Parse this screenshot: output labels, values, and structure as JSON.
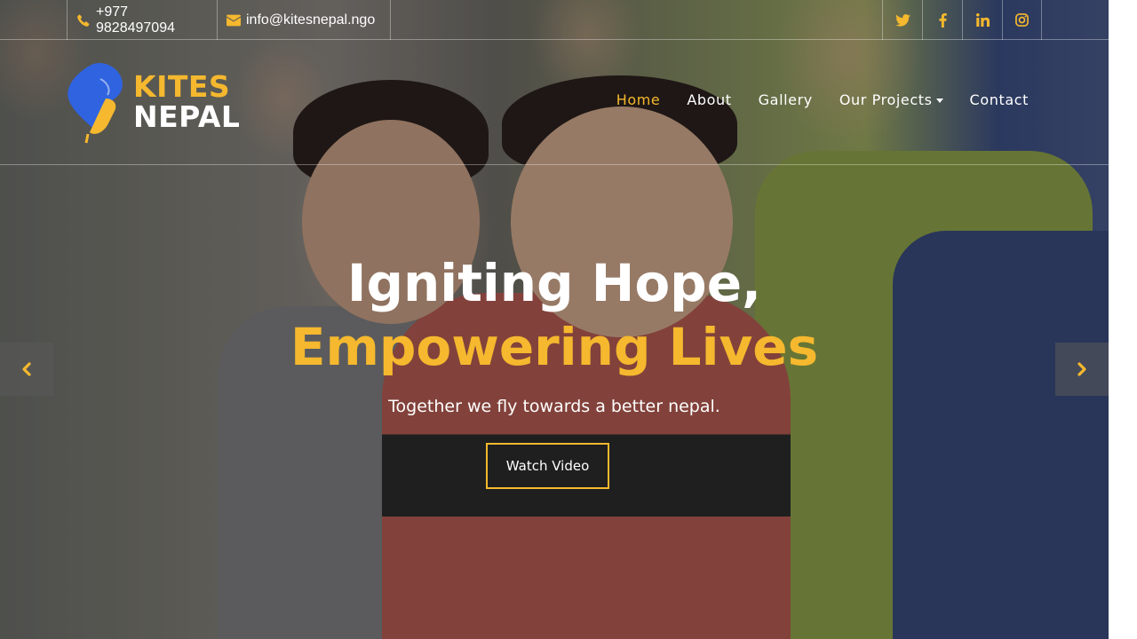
{
  "topbar": {
    "phone": "+977 9828497094",
    "email": "info@kitesnepal.ngo",
    "social": [
      "twitter-icon",
      "facebook-icon",
      "linkedin-icon",
      "instagram-icon"
    ]
  },
  "brand": {
    "line1": "KITES",
    "line2": "NEPAL",
    "colors": {
      "accent": "#f5b82e",
      "logo_blue": "#2f63e0"
    }
  },
  "nav": {
    "items": [
      {
        "label": "Home",
        "active": true
      },
      {
        "label": "About"
      },
      {
        "label": "Gallery"
      },
      {
        "label": "Our Projects",
        "dropdown": true
      },
      {
        "label": "Contact"
      }
    ]
  },
  "hero": {
    "title_line1": "Igniting Hope,",
    "title_line2": "Empowering Lives",
    "subtitle": "Together we fly towards a better nepal.",
    "cta_label": "Watch Video"
  },
  "carousel": {
    "prev_icon": "chevron-left-icon",
    "next_icon": "chevron-right-icon"
  }
}
